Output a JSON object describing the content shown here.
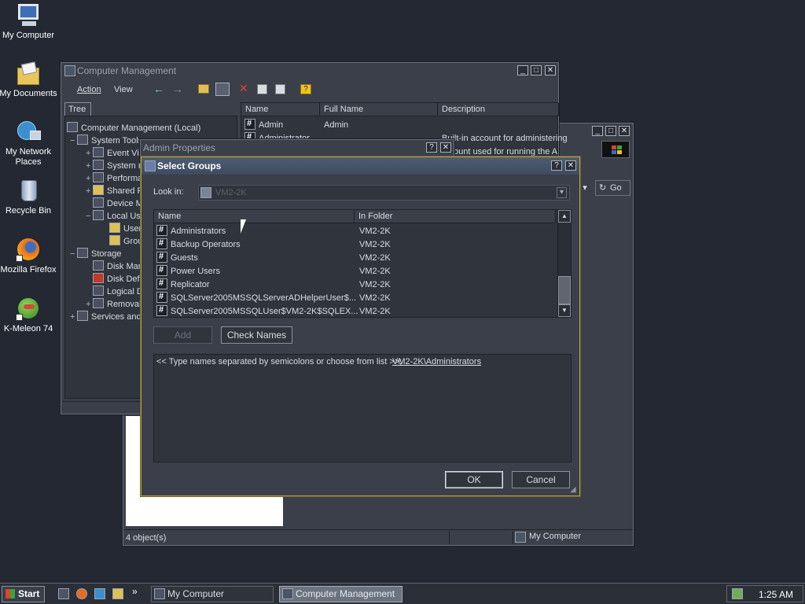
{
  "desktop": {
    "icons": [
      {
        "label": "My Computer"
      },
      {
        "label": "My Documents"
      },
      {
        "label": "My Network Places"
      },
      {
        "label": "Recycle Bin"
      },
      {
        "label": "Mozilla Firefox"
      },
      {
        "label": "K-Meleon 74"
      }
    ]
  },
  "cm_window": {
    "title": "Computer Management",
    "menu": {
      "action": "Action",
      "view": "View"
    },
    "tree_tab": "Tree",
    "tree": [
      "Computer Management (Local)",
      "System Tools",
      "Event Viewer",
      "System Information",
      "Performance Logs and Alerts",
      "Shared Folders",
      "Device Manager",
      "Local Users and Groups",
      "Users",
      "Groups",
      "Storage",
      "Disk Management",
      "Disk Defragmenter",
      "Logical Drives",
      "Removable Storage",
      "Services and Applications"
    ],
    "list_headers": {
      "name": "Name",
      "full_name": "Full Name",
      "description": "Description"
    },
    "list_rows": [
      {
        "name": "Admin",
        "full_name": "Admin",
        "description": ""
      },
      {
        "name": "Administrator",
        "full_name": "",
        "description": "Built-in account for administering"
      },
      {
        "name": "",
        "full_name": "",
        "description": "ount used for running the A"
      }
    ]
  },
  "mycomputer_window": {
    "go_label": "Go",
    "status_left": "4 object(s)",
    "status_right": "My Computer"
  },
  "admin_props": {
    "title": "Admin Properties"
  },
  "select_groups": {
    "title": "Select Groups",
    "look_in_label": "Look in:",
    "look_in_value": "VM2-2K",
    "headers": {
      "name": "Name",
      "folder": "In Folder"
    },
    "rows": [
      {
        "name": "Administrators",
        "folder": "VM2-2K"
      },
      {
        "name": "Backup Operators",
        "folder": "VM2-2K"
      },
      {
        "name": "Guests",
        "folder": "VM2-2K"
      },
      {
        "name": "Power Users",
        "folder": "VM2-2K"
      },
      {
        "name": "Replicator",
        "folder": "VM2-2K"
      },
      {
        "name": "SQLServer2005MSSQLServerADHelperUser$...",
        "folder": "VM2-2K"
      },
      {
        "name": "SQLServer2005MSSQLUser$VM2-2K$SQLEX...",
        "folder": "VM2-2K"
      }
    ],
    "add_label": "Add",
    "check_names_label": "Check Names",
    "prompt_text": "<< Type names separated by semicolons or choose from list >>;",
    "selected_link": "VM2-2K\\Administrators",
    "ok_label": "OK",
    "cancel_label": "Cancel"
  },
  "taskbar": {
    "start_label": "Start",
    "chevron": "»",
    "tasks": [
      {
        "label": "My Computer"
      },
      {
        "label": "Computer Management"
      }
    ],
    "clock": "1:25 AM"
  }
}
